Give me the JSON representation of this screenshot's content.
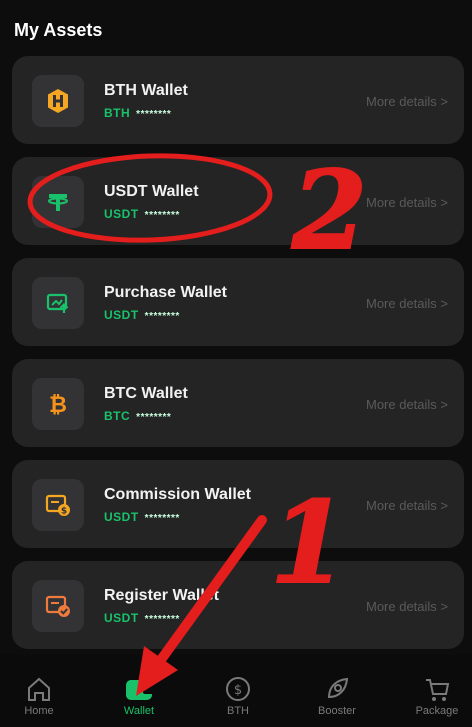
{
  "header": {
    "title": "My Assets"
  },
  "wallets": [
    {
      "name": "BTH Wallet",
      "currency": "BTH",
      "masked": "********",
      "more": "More details >",
      "icon": "bth-icon"
    },
    {
      "name": "USDT Wallet",
      "currency": "USDT",
      "masked": "********",
      "more": "More details >",
      "icon": "tether-icon"
    },
    {
      "name": "Purchase Wallet",
      "currency": "USDT",
      "masked": "********",
      "more": "More details >",
      "icon": "purchase-icon"
    },
    {
      "name": "BTC Wallet",
      "currency": "BTC",
      "masked": "********",
      "more": "More details >",
      "icon": "bitcoin-icon"
    },
    {
      "name": "Commission Wallet",
      "currency": "USDT",
      "masked": "********",
      "more": "More details >",
      "icon": "commission-icon"
    },
    {
      "name": "Register Wallet",
      "currency": "USDT",
      "masked": "********",
      "more": "More details >",
      "icon": "register-icon"
    }
  ],
  "nav": {
    "items": [
      {
        "label": "Home",
        "icon": "home-icon"
      },
      {
        "label": "Wallet",
        "icon": "wallet-icon",
        "active": true
      },
      {
        "label": "BTH",
        "icon": "coin-icon"
      },
      {
        "label": "Booster",
        "icon": "rocket-icon"
      },
      {
        "label": "Package",
        "icon": "cart-icon"
      }
    ]
  },
  "annotations": {
    "number_1": "1",
    "number_2": "2"
  },
  "colors": {
    "accent": "#19c26a",
    "annotation": "#e41d1d",
    "card": "#242424",
    "background": "#0d0d0d"
  }
}
